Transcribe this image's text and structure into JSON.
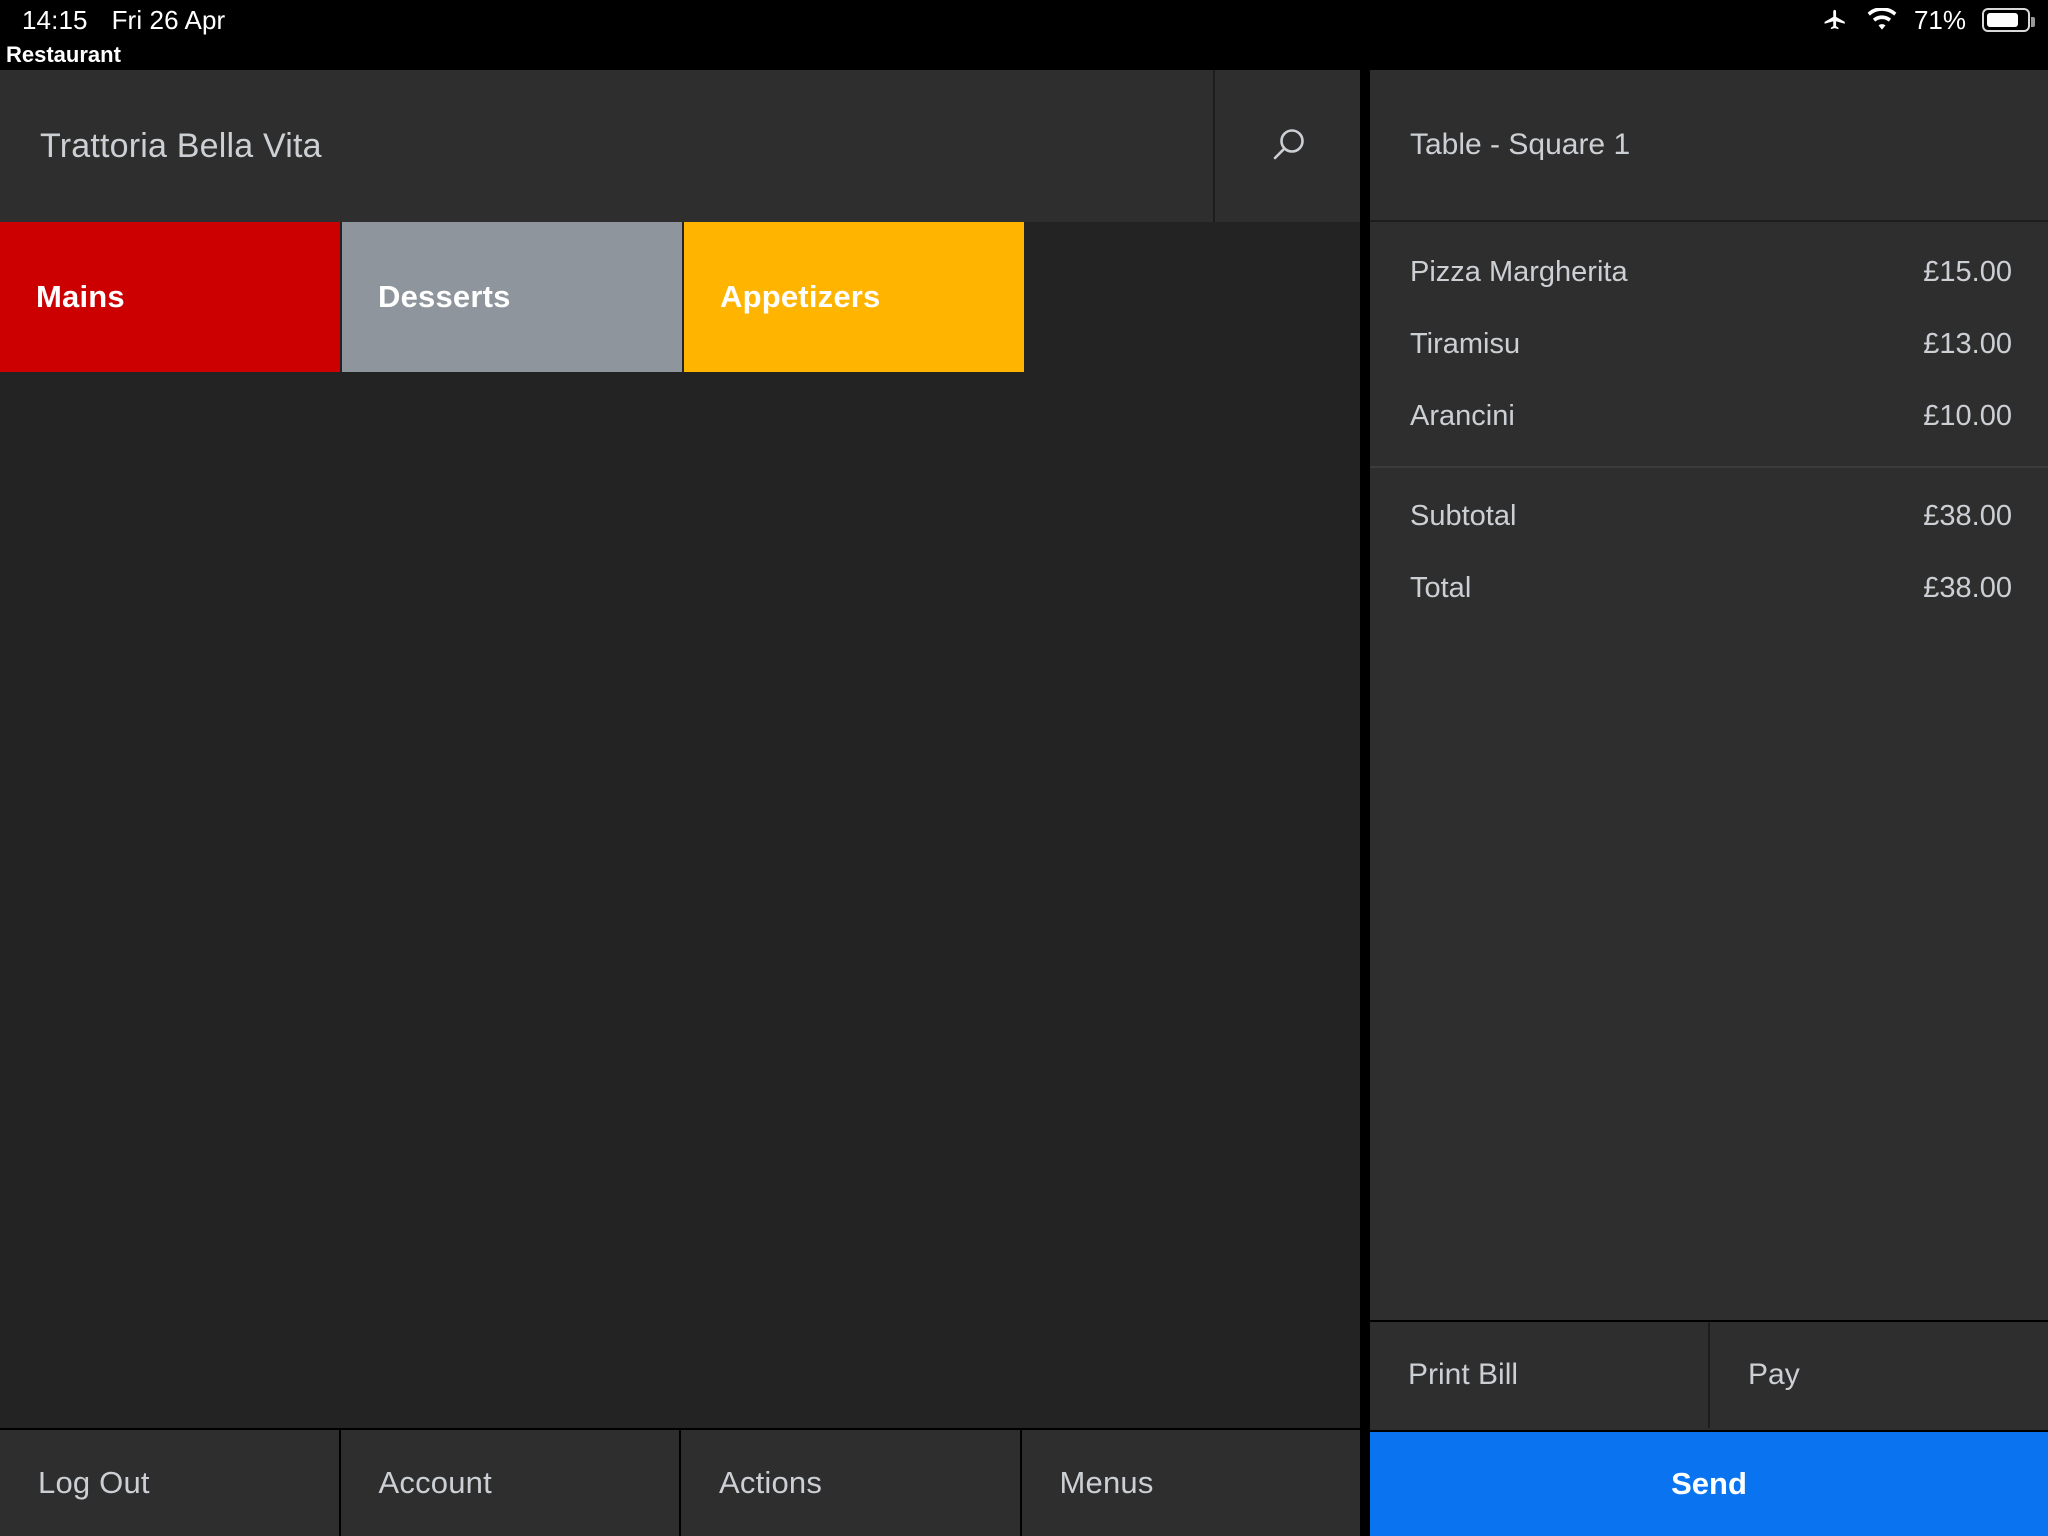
{
  "status_bar": {
    "time": "14:15",
    "date": "Fri 26 Apr",
    "battery_percent": "71%",
    "battery_level": 71,
    "icons": [
      "airplane-mode-icon",
      "wifi-icon",
      "battery-icon"
    ]
  },
  "app_label": "Restaurant",
  "left_panel": {
    "venue_title": "Trattoria Bella Vita",
    "search_icon": "search-icon",
    "categories": [
      {
        "label": "Mains",
        "color": "#CC0000",
        "text_color": "#FFFFFF",
        "selected": true
      },
      {
        "label": "Desserts",
        "color": "#8E959C",
        "text_color": "#FFFFFF",
        "selected": false
      },
      {
        "label": "Appetizers",
        "color": "#FFB400",
        "text_color": "#FFFFFF",
        "selected": false
      }
    ],
    "bottom_nav": [
      {
        "label": "Log Out"
      },
      {
        "label": "Account"
      },
      {
        "label": "Actions"
      },
      {
        "label": "Menus"
      }
    ]
  },
  "right_panel": {
    "title": "Table - Square 1",
    "items": [
      {
        "name": "Pizza Margherita",
        "price": "£15.00"
      },
      {
        "name": "Tiramisu",
        "price": "£13.00"
      },
      {
        "name": "Arancini",
        "price": "£10.00"
      }
    ],
    "totals": [
      {
        "label": "Subtotal",
        "value": "£38.00"
      },
      {
        "label": "Total",
        "value": "£38.00"
      }
    ],
    "actions": [
      {
        "label": "Print Bill"
      },
      {
        "label": "Pay"
      }
    ],
    "send": {
      "label": "Send",
      "color": "#0A74F0"
    }
  },
  "theme": {
    "background": "#000000",
    "panel_dark": "#232323",
    "panel_mid": "#2E2E2E",
    "text_primary": "#CCD0D4",
    "accent_blue": "#0A74F0"
  }
}
